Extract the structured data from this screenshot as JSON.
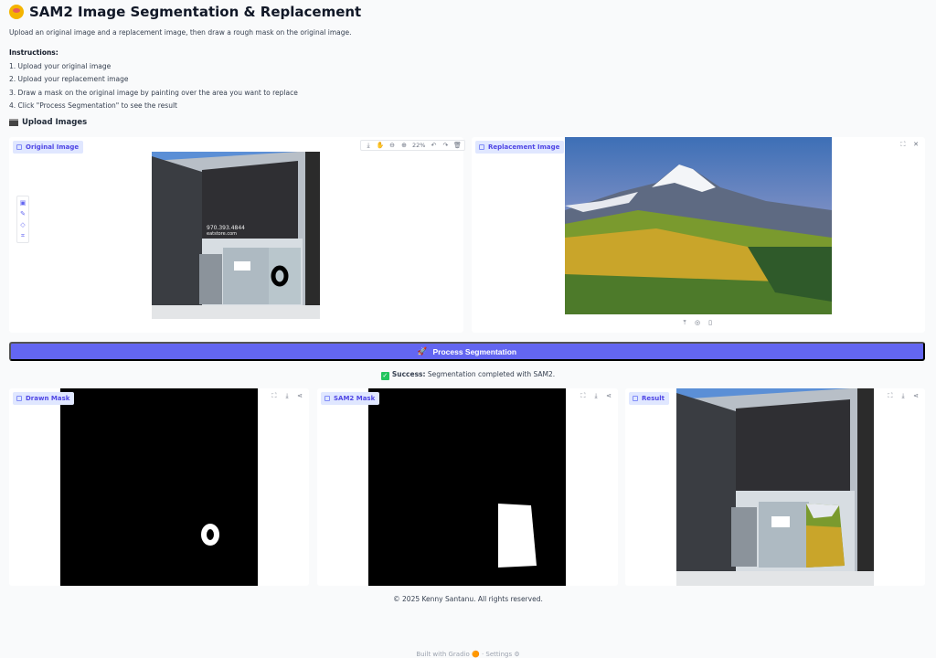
{
  "header": {
    "title": "SAM2 Image Segmentation & Replacement",
    "subtitle": "Upload an original image and a replacement image, then draw a rough mask on the original image."
  },
  "instructions": {
    "heading": "Instructions:",
    "steps": [
      "1. Upload your original image",
      "2. Upload your replacement image",
      "3. Draw a mask on the original image by painting over the area you want to replace",
      "4. Click \"Process Segmentation\" to see the result"
    ]
  },
  "section": {
    "upload_heading": "Upload Images"
  },
  "original_panel": {
    "label": "Original Image",
    "zoom": "22%"
  },
  "replacement_panel": {
    "label": "Replacement Image"
  },
  "process_button": {
    "label": "Process Segmentation"
  },
  "status": {
    "prefix": "Success:",
    "message": "Segmentation completed with SAM2."
  },
  "outputs": {
    "drawn_mask": {
      "label": "Drawn Mask"
    },
    "sam2_mask": {
      "label": "SAM2 Mask"
    },
    "result": {
      "label": "Result"
    }
  },
  "storefront": {
    "phone": "970.393.4844",
    "site": "eatstore.com"
  },
  "footer": {
    "copyright": "© 2025 Kenny Santanu. All rights reserved."
  },
  "bottom_bar": {
    "built_with": "Built with Gradio",
    "settings": "Settings"
  },
  "colors": {
    "accent": "#6366f1",
    "label_bg": "#e0e7ff",
    "success": "#22c55e"
  }
}
